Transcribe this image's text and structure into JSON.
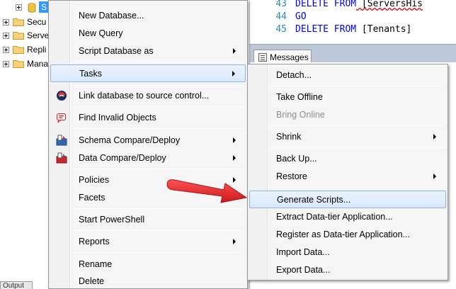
{
  "tree": {
    "db_label": "S",
    "folders": [
      "Secu",
      "Serve",
      "Repli",
      "Mana"
    ]
  },
  "editor": {
    "lines": [
      {
        "num": "43",
        "kw": "DELETE FROM",
        "rest": " [ServersHis"
      },
      {
        "num": "44",
        "kw": "GO",
        "rest": ""
      },
      {
        "num": "45",
        "kw": "DELETE FROM",
        "rest": " [Tenants]"
      }
    ]
  },
  "results": {
    "messages_tab": "Messages"
  },
  "output_tab": "Output",
  "main_menu": {
    "items": [
      {
        "label": "New Database...",
        "icon": null,
        "submenu": false
      },
      {
        "label": "New Query",
        "icon": null,
        "submenu": false
      },
      {
        "label": "Script Database as",
        "icon": null,
        "submenu": true
      },
      {
        "label": "Tasks",
        "icon": null,
        "submenu": true,
        "highlighted": true
      },
      {
        "label": "Link database to source control...",
        "icon": "source-control-icon",
        "submenu": false
      },
      {
        "label": "Find Invalid Objects",
        "icon": "find-invalid-icon",
        "submenu": false
      },
      {
        "label": "Schema Compare/Deploy",
        "icon": "schema-compare-icon",
        "submenu": true
      },
      {
        "label": "Data Compare/Deploy",
        "icon": "data-compare-icon",
        "submenu": true
      },
      {
        "label": "Policies",
        "icon": null,
        "submenu": true
      },
      {
        "label": "Facets",
        "icon": null,
        "submenu": false
      },
      {
        "label": "Start PowerShell",
        "icon": null,
        "submenu": false
      },
      {
        "label": "Reports",
        "icon": null,
        "submenu": true
      },
      {
        "label": "Rename",
        "icon": null,
        "submenu": false
      },
      {
        "label": "Delete",
        "icon": null,
        "submenu": false
      }
    ]
  },
  "tasks_menu": {
    "items": [
      {
        "label": "Detach...",
        "submenu": false,
        "disabled": false
      },
      {
        "label": "Take Offline",
        "submenu": false,
        "disabled": false
      },
      {
        "label": "Bring Online",
        "submenu": false,
        "disabled": true
      },
      {
        "label": "Shrink",
        "submenu": true,
        "disabled": false
      },
      {
        "label": "Back Up...",
        "submenu": false,
        "disabled": false
      },
      {
        "label": "Restore",
        "submenu": true,
        "disabled": false
      },
      {
        "label": "Generate Scripts...",
        "submenu": false,
        "disabled": false,
        "highlighted": true
      },
      {
        "label": "Extract Data-tier Application...",
        "submenu": false,
        "disabled": false
      },
      {
        "label": "Register as Data-tier Application...",
        "submenu": false,
        "disabled": false
      },
      {
        "label": "Import Data...",
        "submenu": false,
        "disabled": false
      },
      {
        "label": "Export Data...",
        "submenu": false,
        "disabled": false
      }
    ]
  },
  "colors": {
    "highlight_border": "#8fb4e4",
    "selection_blue": "#3399ff",
    "annotation_red": "#e0141a",
    "keyword_blue": "#0000ff",
    "line_number": "#2b91af"
  }
}
